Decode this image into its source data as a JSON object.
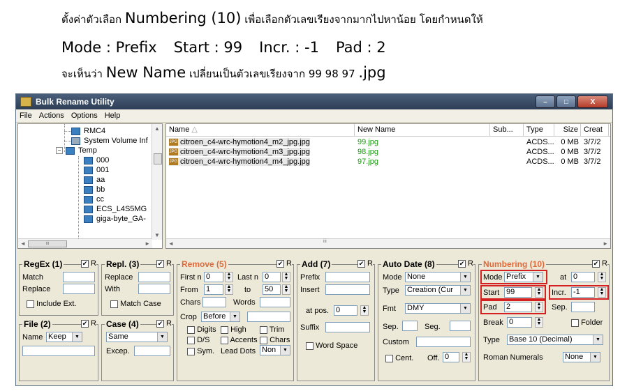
{
  "instructions": {
    "line1_pre": "ตั้งค่าตัวเลือก ",
    "line1_big": "Numbering (10)",
    "line1_post": " เพื่อเลือกตัวเลขเรียงจากมากไปหาน้อย โดยกำหนดให้",
    "line2_mode": "Mode : Prefix",
    "line2_start": "Start : 99",
    "line2_incr": "Incr. : -1",
    "line2_pad": "Pad : 2",
    "line3_pre": "จะเห็นว่า ",
    "line3_big": "New Name",
    "line3_mid": " เปลี่ยนเป็นตัวเลขเรียงจาก 99 98 97 ",
    "line3_ext": ".jpg"
  },
  "window": {
    "title": "Bulk Rename Utility",
    "minimize": "–",
    "maximize": "□",
    "close": "X"
  },
  "menu": [
    "File",
    "Actions",
    "Options",
    "Help"
  ],
  "tree": {
    "items": [
      "RMC4",
      "System Volume Inf",
      "Temp",
      "000",
      "001",
      "aa",
      "bb",
      "cc",
      "ECS_L4S5MG",
      "giga-byte_GA-"
    ],
    "scroll_hint": "iii"
  },
  "files": {
    "columns": [
      "Name",
      "New Name",
      "Sub...",
      "Type",
      "Size",
      "Creat"
    ],
    "rows": [
      {
        "name": "citroen_c4-wrc-hymotion4_m2_jpg.jpg",
        "new": "99.jpg",
        "type": "ACDS...",
        "size": "0 MB",
        "created": "3/7/2"
      },
      {
        "name": "citroen_c4-wrc-hymotion4_m3_jpg.jpg",
        "new": "98.jpg",
        "type": "ACDS...",
        "size": "0 MB",
        "created": "3/7/2"
      },
      {
        "name": "citroen_c4-wrc-hymotion4_m4_jpg.jpg",
        "new": "97.jpg",
        "type": "ACDS...",
        "size": "0 MB",
        "created": "3/7/2"
      }
    ],
    "scroll_hint": "iii"
  },
  "regex": {
    "title": "RegEx (1)",
    "chk": "R",
    "match": "Match",
    "replace": "Replace",
    "include": "Include Ext."
  },
  "file": {
    "title": "File (2)",
    "chk": "R",
    "name": "Name",
    "value": "Keep"
  },
  "repl": {
    "title": "Repl. (3)",
    "chk": "R",
    "replace": "Replace",
    "with": "With",
    "match_case": "Match Case"
  },
  "case": {
    "title": "Case (4)",
    "chk": "R",
    "value": "Same",
    "excep": "Excep."
  },
  "remove": {
    "title": "Remove (5)",
    "chk": "R",
    "firstn": "First n",
    "firstn_val": "0",
    "lastn": "Last n",
    "lastn_val": "0",
    "from": "From",
    "from_val": "1",
    "to": "to",
    "to_val": "50",
    "chars": "Chars",
    "words": "Words",
    "crop": "Crop",
    "crop_val": "Before",
    "digits": "Digits",
    "high": "High",
    "trim": "Trim",
    "ds": "D/S",
    "accents": "Accents",
    "chars2": "Chars",
    "sym": "Sym.",
    "lead_dots": "Lead Dots",
    "lead_val": "Non"
  },
  "add": {
    "title": "Add (7)",
    "chk": "R",
    "prefix": "Prefix",
    "insert": "Insert",
    "at_pos": "at pos.",
    "at_pos_val": "0",
    "suffix": "Suffix",
    "word_space": "Word Space"
  },
  "autodate": {
    "title": "Auto Date (8)",
    "chk": "R",
    "mode": "Mode",
    "mode_val": "None",
    "type": "Type",
    "type_val": "Creation (Cur",
    "fmt": "Fmt",
    "fmt_val": "DMY",
    "sep": "Sep.",
    "seg": "Seg.",
    "custom": "Custom",
    "cent": "Cent.",
    "off": "Off.",
    "off_val": "0"
  },
  "numbering": {
    "title": "Numbering (10)",
    "chk": "R",
    "mode": "Mode",
    "mode_val": "Prefix",
    "at": "at",
    "at_val": "0",
    "start": "Start",
    "start_val": "99",
    "incr": "Incr.",
    "incr_val": "-1",
    "pad": "Pad",
    "pad_val": "2",
    "sep": "Sep.",
    "break": "Break",
    "break_val": "0",
    "folder": "Folder",
    "type": "Type",
    "type_val": "Base 10 (Decimal)",
    "roman": "Roman Numerals",
    "roman_val": "None"
  },
  "colors": {
    "accent_red": "#d42020",
    "new_name_green": "#1a9a10",
    "section_orange": "#e06a3a"
  }
}
